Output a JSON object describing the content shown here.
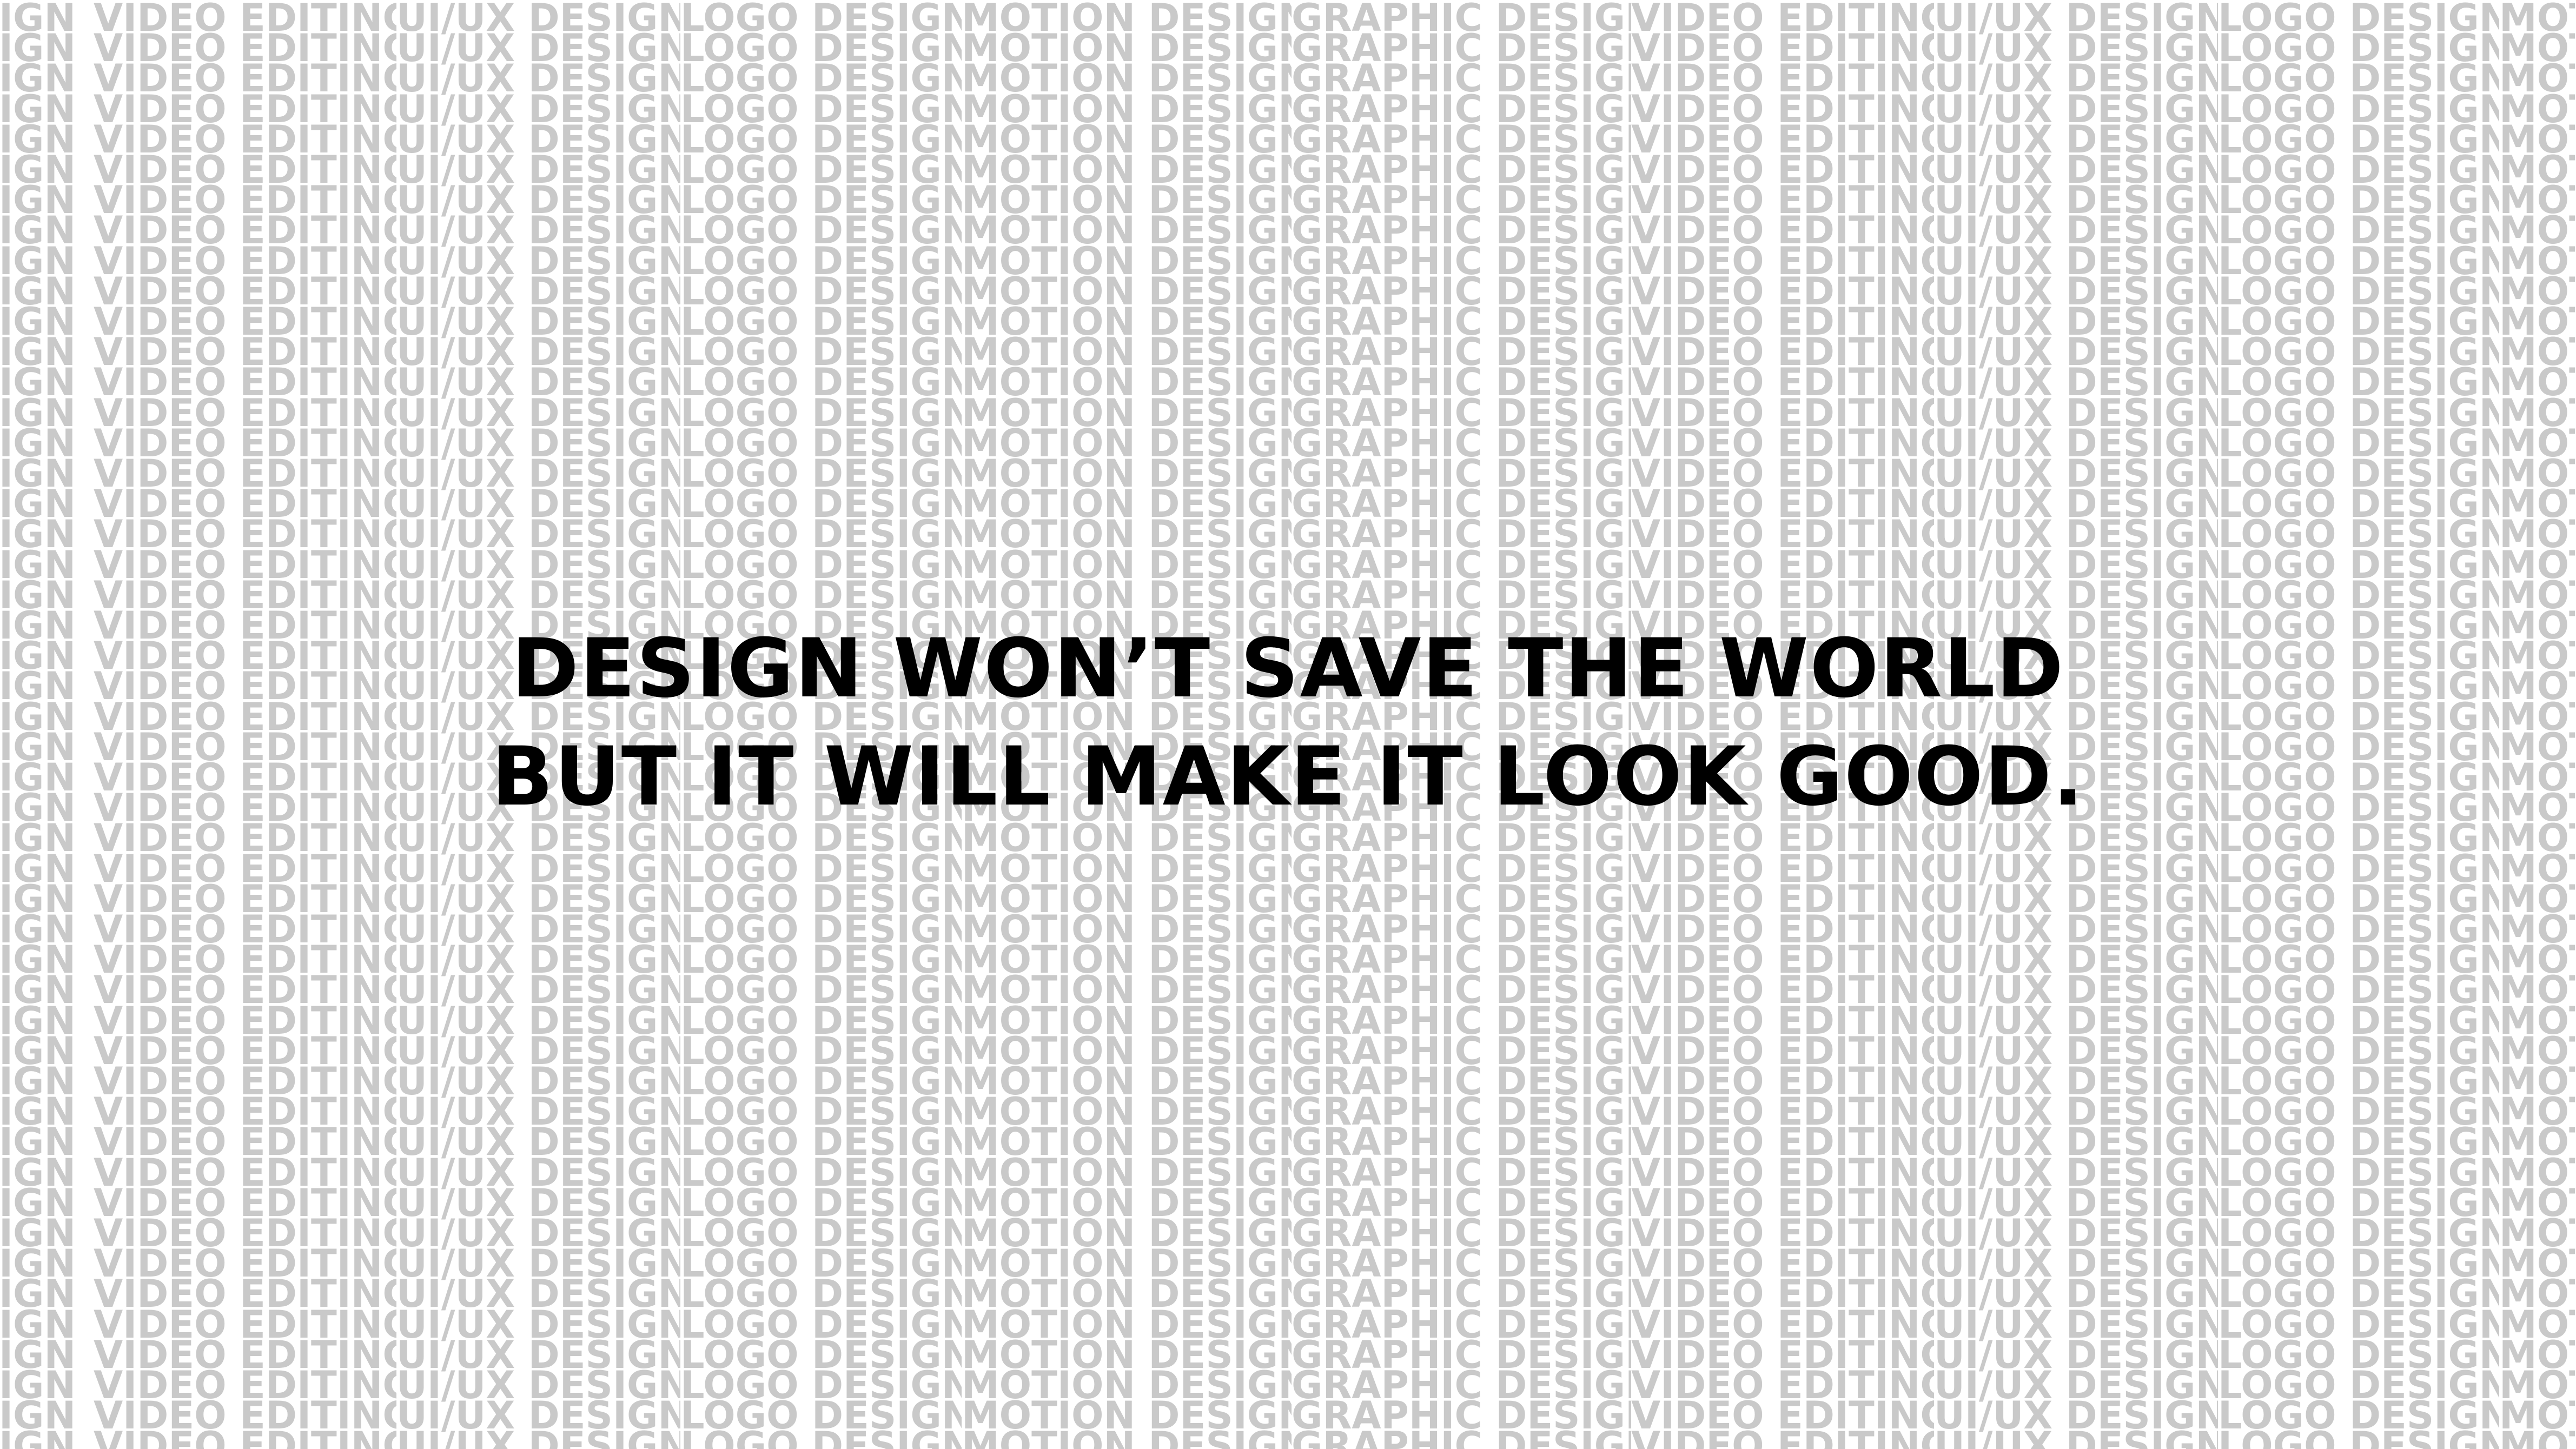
{
  "background_pattern": {
    "segments": [
      "IGN •",
      "VIDEO EDITING •",
      "UI/UX DESIGN •",
      "LOGO DESIGN •",
      "MOTION DESIGN •",
      "GRAPHIC DESIGN •",
      "VIDEO EDITING •",
      "UI/UX DESIGN •",
      "LOGO DESIGN •",
      "MOT"
    ]
  },
  "headline": {
    "line1": "DESIGN WON’T SAVE THE WORLD",
    "line2": "BUT IT WILL MAKE IT LOOK GOOD."
  },
  "colors": {
    "background": "#ffffff",
    "pattern_text": "#c9c9c9",
    "headline_text": "#000000"
  }
}
